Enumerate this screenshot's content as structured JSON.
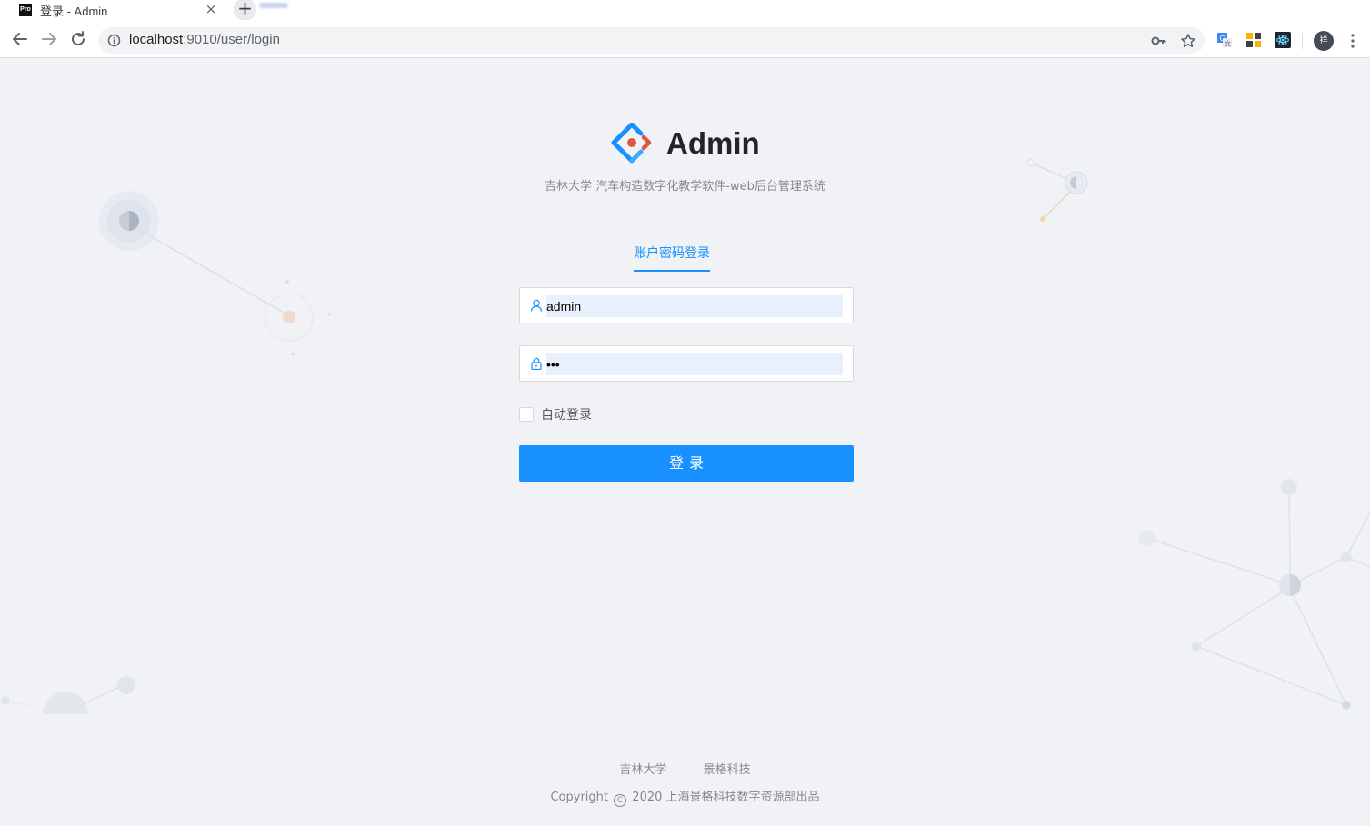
{
  "browser": {
    "tab_title": "登录 - Admin",
    "favicon_text": "Pro",
    "tab_close": "×",
    "new_tab": "+",
    "url_host": "localhost",
    "url_rest": ":9010/user/login",
    "profile_initial": "祥"
  },
  "header": {
    "app_title": "Admin",
    "subtitle": "吉林大学 汽车构造数字化教学软件-web后台管理系统"
  },
  "login": {
    "tab_label": "账户密码登录",
    "username_value": "admin",
    "password_value": "•••",
    "remember_label": "自动登录",
    "remember_checked": false,
    "submit_label": "登录"
  },
  "footer": {
    "links": [
      "吉林大学",
      "景格科技"
    ],
    "copyright_prefix": "Copyright",
    "copyright_symbol": "C",
    "copyright_text": "2020 上海景格科技数字资源部出品"
  },
  "colors": {
    "primary": "#1890ff",
    "page_bg": "#f0f2f5",
    "logo_blue": "#1890ff",
    "logo_red": "#e2563d"
  }
}
